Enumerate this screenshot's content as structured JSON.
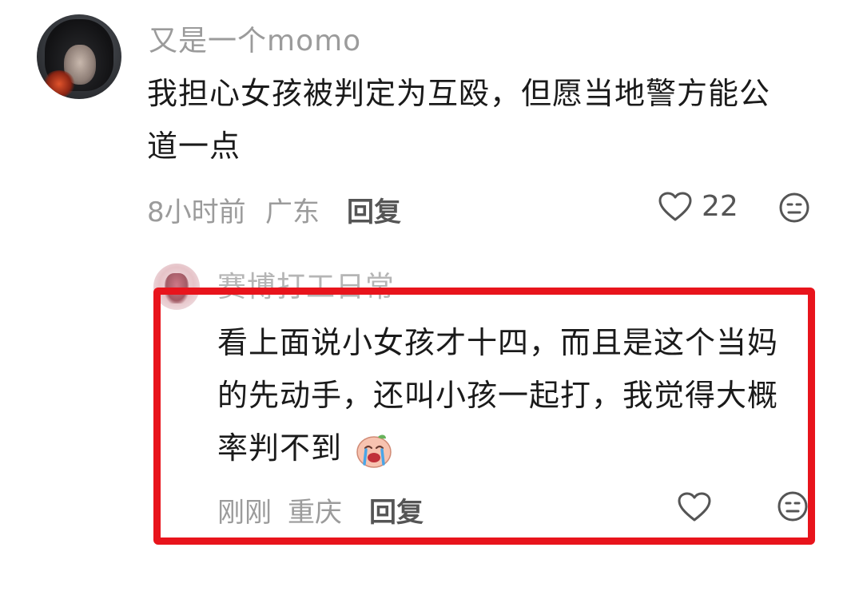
{
  "comment": {
    "username": "又是一个momo",
    "text_line1": "我担心女孩被判定为互殴，但愿当地警方能公",
    "text_line2": "道一点",
    "time": "8小时前",
    "location": "广东",
    "reply_label": "回复",
    "like_count": "22"
  },
  "reply": {
    "username": "赛博打工日常",
    "text_line1": "看上面说小女孩才十四，而且是这个当妈",
    "text_line2": "的先动手，还叫小孩一起打，我觉得大概",
    "text_line3": "率判不到",
    "time": "刚刚",
    "location": "重庆",
    "reply_label": "回复",
    "emoji": "crying-face-emoji"
  },
  "colors": {
    "highlight": "#e8141c",
    "meta_text": "#9b9b9b",
    "body_text": "#1a1a1a"
  }
}
